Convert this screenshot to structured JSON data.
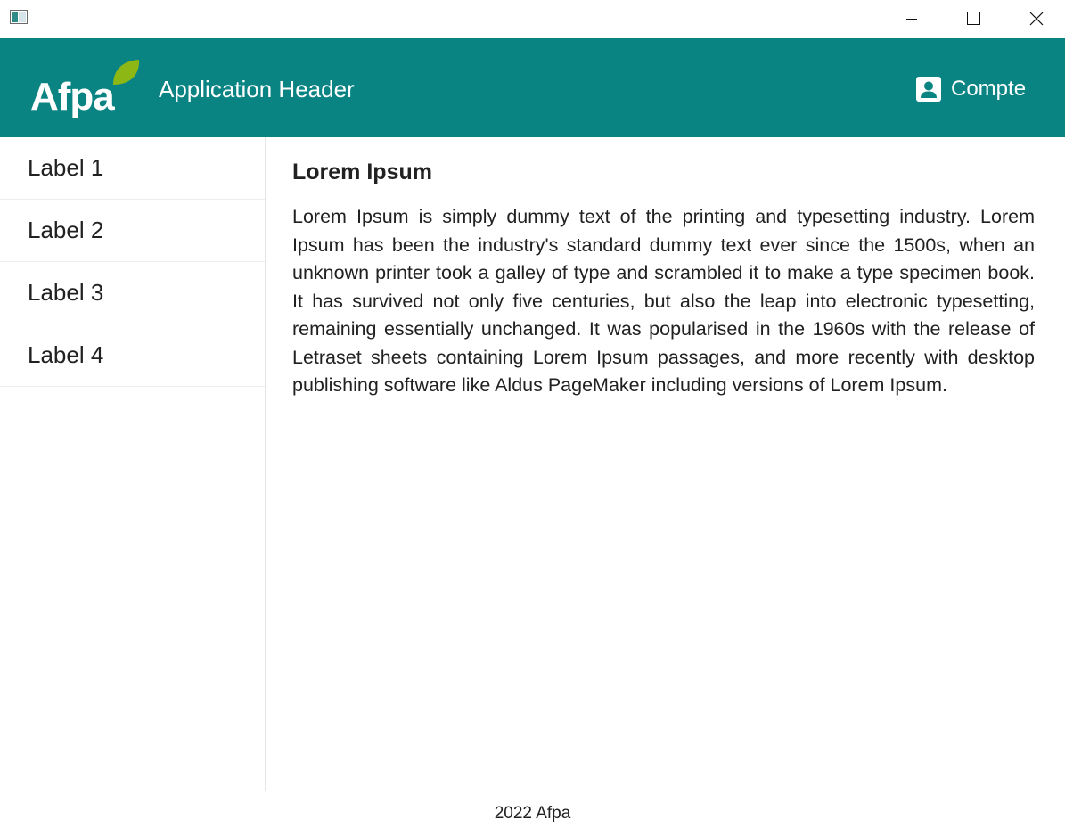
{
  "window": {
    "controls": {
      "minimize_icon": "minimize-icon",
      "maximize_icon": "maximize-icon",
      "close_icon": "close-icon"
    }
  },
  "header": {
    "logo_text": "Afpa",
    "title": "Application Header",
    "account_label": "Compte",
    "account_icon": "account-box-icon",
    "background_color": "#0a8483",
    "logo_leaf_color": "#8cb714"
  },
  "sidebar": {
    "items": [
      {
        "label": "Label 1"
      },
      {
        "label": "Label 2"
      },
      {
        "label": "Label 3"
      },
      {
        "label": "Label 4"
      }
    ]
  },
  "main": {
    "heading": "Lorem Ipsum",
    "body": "Lorem Ipsum is simply dummy text of the printing and typesetting industry. Lorem Ipsum has been the industry's standard dummy text ever since the 1500s, when an unknown printer took a galley of type and scrambled it to make a type specimen book. It has survived not only five centuries, but also the leap into electronic typesetting, remaining essentially unchanged. It was popularised in the 1960s with the release of Letraset sheets containing Lorem Ipsum passages, and more recently with desktop publishing software like Aldus PageMaker including versions of Lorem Ipsum."
  },
  "footer": {
    "text": "2022 Afpa"
  }
}
